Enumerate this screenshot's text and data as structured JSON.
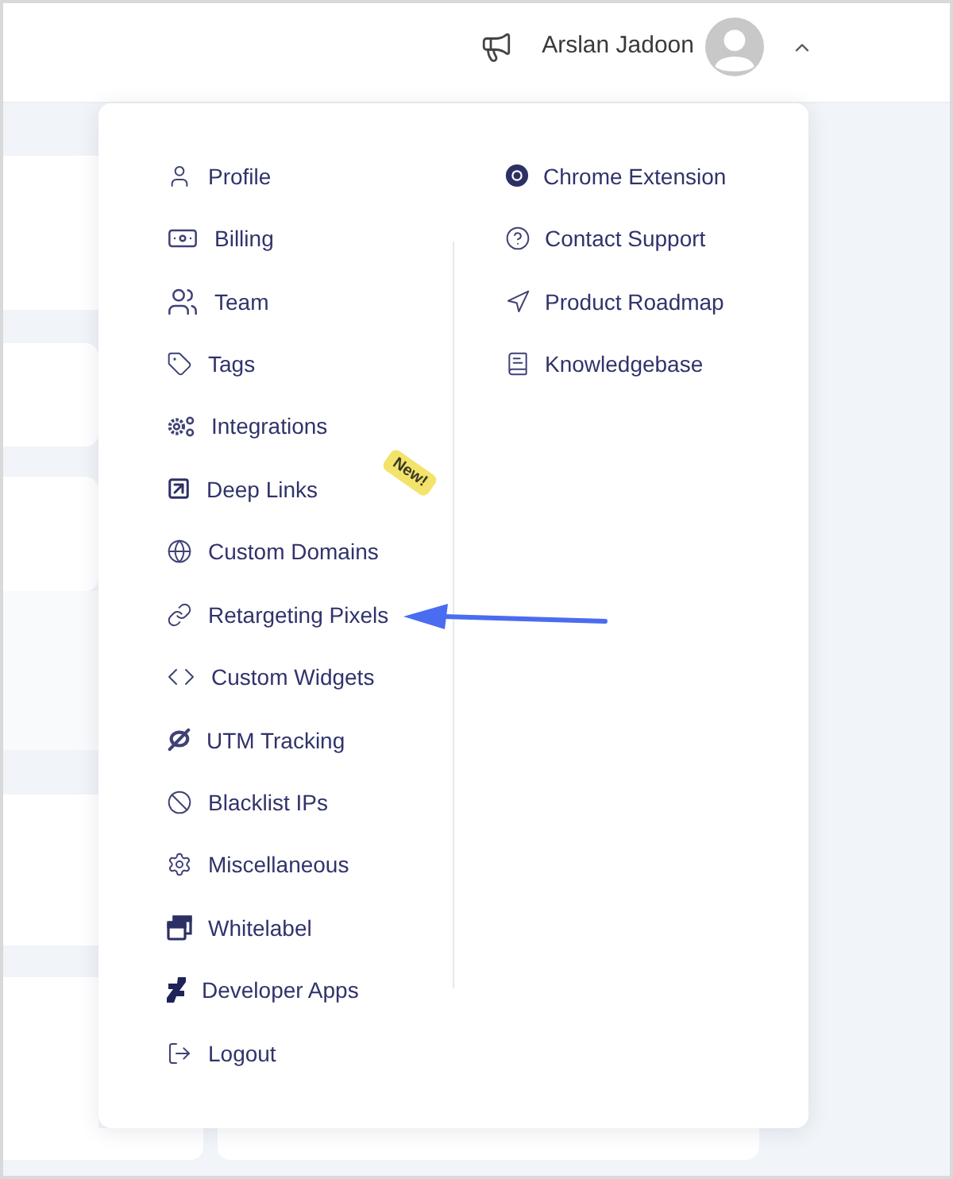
{
  "header": {
    "user_name": "Arslan Jadoon",
    "user_menu": {
      "expanded": true
    }
  },
  "dropdown": {
    "columns": [
      {
        "items": [
          {
            "label": "Profile"
          },
          {
            "label": "Billing"
          },
          {
            "label": "Team"
          },
          {
            "label": "Tags"
          },
          {
            "label": "Integrations"
          },
          {
            "label": "Deep Links",
            "badge": "New!"
          },
          {
            "label": "Custom Domains"
          },
          {
            "label": "Retargeting Pixels"
          },
          {
            "label": "Custom Widgets"
          },
          {
            "label": "UTM Tracking"
          },
          {
            "label": "Blacklist IPs"
          },
          {
            "label": "Miscellaneous"
          },
          {
            "label": "Whitelabel"
          },
          {
            "label": "Developer Apps"
          },
          {
            "label": "Logout"
          }
        ]
      },
      {
        "items": [
          {
            "label": "Chrome Extension"
          },
          {
            "label": "Contact Support"
          },
          {
            "label": "Product Roadmap"
          },
          {
            "label": "Knowledgebase"
          }
        ]
      }
    ]
  }
}
